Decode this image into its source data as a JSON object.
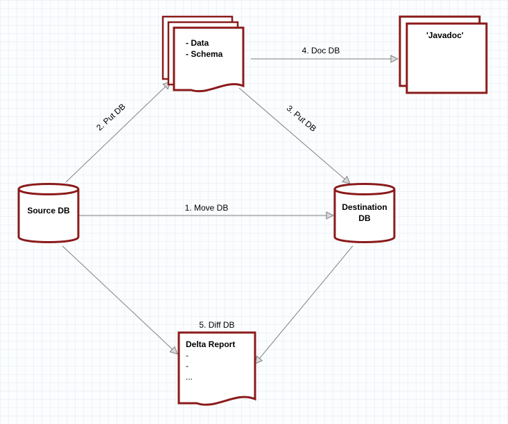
{
  "nodes": {
    "source_db": "Source DB",
    "destination_db": "Destination\nDB",
    "data_schema_line1": "- Data",
    "data_schema_line2": "- Schema",
    "javadoc": "'Javadoc'",
    "delta_title": "Delta Report",
    "delta_l1": "-",
    "delta_l2": "-",
    "delta_l3": "..."
  },
  "edges": {
    "move_db": "1. Move DB",
    "put_db_up": "2. Put DB",
    "put_db_down": "3. Put DB",
    "doc_db": "4. Doc DB",
    "diff_db": "5. Diff DB"
  },
  "style": {
    "node_stroke": "#8b1a1a",
    "node_fill": "#ffffff",
    "arrow_stroke": "#808080",
    "arrow_fill": "#d9d9d9"
  }
}
